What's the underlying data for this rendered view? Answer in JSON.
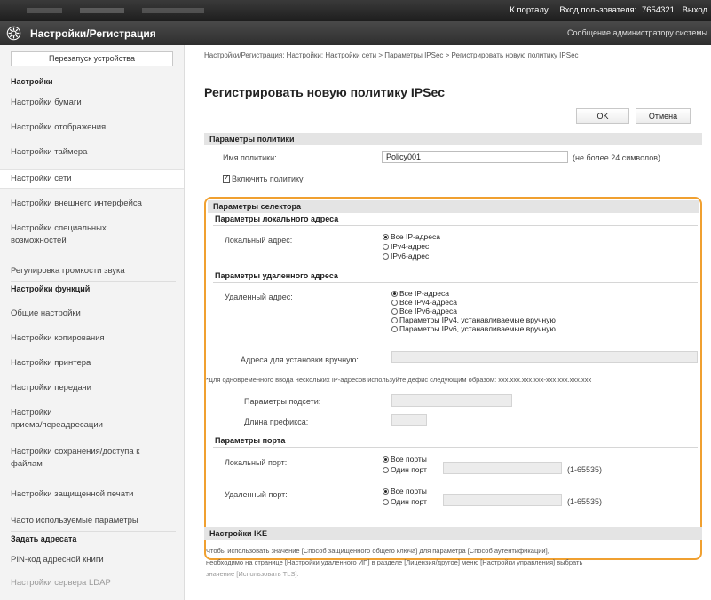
{
  "topbar": {
    "portal_link": "К порталу",
    "login_label": "Вход пользователя:",
    "user_id": "7654321",
    "logout": "Выход"
  },
  "header": {
    "title": "Настройки/Регистрация",
    "admin_msg": "Сообщение администратору системы"
  },
  "sidebar": {
    "restart": "Перезапуск устройства",
    "section_settings": "Настройки",
    "items1": [
      "Настройки бумаги",
      "Настройки отображения",
      "Настройки таймера",
      "Настройки сети",
      "Настройки внешнего интерфейса",
      "Настройки специальных",
      "возможностей",
      "Регулировка громкости звука"
    ],
    "section_functions": "Настройки функций",
    "items2": [
      "Общие настройки",
      "Настройки копирования",
      "Настройки принтера",
      "Настройки передачи",
      "Настройки",
      "приема/переадресации",
      "Настройки сохранения/доступа к",
      "файлам",
      "Настройки защищенной печати",
      "Часто используемые параметры"
    ],
    "section_dest": "Задать адресата",
    "items3": [
      "PIN-код адресной книги",
      "Настройки сервера LDAP"
    ]
  },
  "main": {
    "breadcrumb": "Настройки/Регистрация: Настройки: Настройки сети > Параметры IPSec > Регистрировать новую политику IPSec",
    "title": "Регистрировать новую политику IPSec",
    "ok_label": "OK",
    "cancel_label": "Отмена",
    "policy": {
      "heading": "Параметры политики",
      "name_label": "Имя политики:",
      "name_value": "Policy001",
      "name_hint": "(не более 24 символов)",
      "enable_label": "Включить политику"
    },
    "selector": {
      "heading": "Параметры селектора",
      "local_heading": "Параметры локального адреса",
      "local_label": "Локальный адрес:",
      "local_options": [
        "Все IP-адреса",
        "IPv4-адрес",
        "IPv6-адрес"
      ],
      "remote_heading": "Параметры удаленного адреса",
      "remote_label": "Удаленный адрес:",
      "remote_options": [
        "Все IP-адреса",
        "Все IPv4-адреса",
        "Все IPv6-адреса",
        "Параметры IPv4, устанавливаемые вручную",
        "Параметры IPv6, устанавливаемые вручную"
      ],
      "manual_label": "Адреса для установки вручную:",
      "manual_note": "*Для одновременного ввода нескольких IP-адресов используйте дефис следующим образом: xxx.xxx.xxx.xxx-xxx.xxx.xxx.xxx",
      "subnet_label": "Параметры подсети:",
      "prefix_label": "Длина префикса:",
      "port_heading": "Параметры порта",
      "local_port_label": "Локальный порт:",
      "remote_port_label": "Удаленный порт:",
      "port_all": "Все порты",
      "port_one": "Один порт",
      "port_range": "(1-65535)"
    },
    "ike": {
      "heading": "Настройки IKE",
      "note1": "Чтобы использовать значение [Способ защищенного общего ключа] для параметра [Способ аутентификации],",
      "note2": "необходимо на странице [Настройки удаленного ИП] в разделе [Лицензия/другое] меню [Настройки управления] выбрать",
      "note3": "значение [Использовать TLS]."
    }
  }
}
